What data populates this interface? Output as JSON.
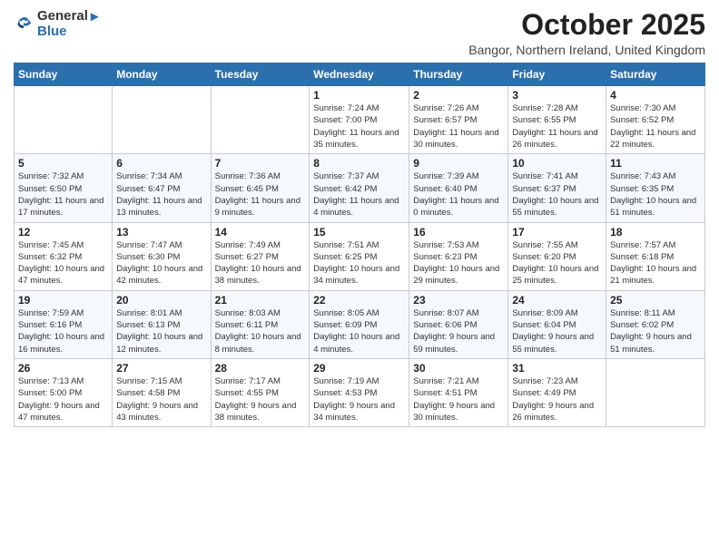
{
  "logo": {
    "general": "General",
    "blue": "Blue"
  },
  "header": {
    "month": "October 2025",
    "location": "Bangor, Northern Ireland, United Kingdom"
  },
  "weekdays": [
    "Sunday",
    "Monday",
    "Tuesday",
    "Wednesday",
    "Thursday",
    "Friday",
    "Saturday"
  ],
  "weeks": [
    [
      {
        "day": "",
        "sunrise": "",
        "sunset": "",
        "daylight": ""
      },
      {
        "day": "",
        "sunrise": "",
        "sunset": "",
        "daylight": ""
      },
      {
        "day": "",
        "sunrise": "",
        "sunset": "",
        "daylight": ""
      },
      {
        "day": "1",
        "sunrise": "Sunrise: 7:24 AM",
        "sunset": "Sunset: 7:00 PM",
        "daylight": "Daylight: 11 hours and 35 minutes."
      },
      {
        "day": "2",
        "sunrise": "Sunrise: 7:26 AM",
        "sunset": "Sunset: 6:57 PM",
        "daylight": "Daylight: 11 hours and 30 minutes."
      },
      {
        "day": "3",
        "sunrise": "Sunrise: 7:28 AM",
        "sunset": "Sunset: 6:55 PM",
        "daylight": "Daylight: 11 hours and 26 minutes."
      },
      {
        "day": "4",
        "sunrise": "Sunrise: 7:30 AM",
        "sunset": "Sunset: 6:52 PM",
        "daylight": "Daylight: 11 hours and 22 minutes."
      }
    ],
    [
      {
        "day": "5",
        "sunrise": "Sunrise: 7:32 AM",
        "sunset": "Sunset: 6:50 PM",
        "daylight": "Daylight: 11 hours and 17 minutes."
      },
      {
        "day": "6",
        "sunrise": "Sunrise: 7:34 AM",
        "sunset": "Sunset: 6:47 PM",
        "daylight": "Daylight: 11 hours and 13 minutes."
      },
      {
        "day": "7",
        "sunrise": "Sunrise: 7:36 AM",
        "sunset": "Sunset: 6:45 PM",
        "daylight": "Daylight: 11 hours and 9 minutes."
      },
      {
        "day": "8",
        "sunrise": "Sunrise: 7:37 AM",
        "sunset": "Sunset: 6:42 PM",
        "daylight": "Daylight: 11 hours and 4 minutes."
      },
      {
        "day": "9",
        "sunrise": "Sunrise: 7:39 AM",
        "sunset": "Sunset: 6:40 PM",
        "daylight": "Daylight: 11 hours and 0 minutes."
      },
      {
        "day": "10",
        "sunrise": "Sunrise: 7:41 AM",
        "sunset": "Sunset: 6:37 PM",
        "daylight": "Daylight: 10 hours and 55 minutes."
      },
      {
        "day": "11",
        "sunrise": "Sunrise: 7:43 AM",
        "sunset": "Sunset: 6:35 PM",
        "daylight": "Daylight: 10 hours and 51 minutes."
      }
    ],
    [
      {
        "day": "12",
        "sunrise": "Sunrise: 7:45 AM",
        "sunset": "Sunset: 6:32 PM",
        "daylight": "Daylight: 10 hours and 47 minutes."
      },
      {
        "day": "13",
        "sunrise": "Sunrise: 7:47 AM",
        "sunset": "Sunset: 6:30 PM",
        "daylight": "Daylight: 10 hours and 42 minutes."
      },
      {
        "day": "14",
        "sunrise": "Sunrise: 7:49 AM",
        "sunset": "Sunset: 6:27 PM",
        "daylight": "Daylight: 10 hours and 38 minutes."
      },
      {
        "day": "15",
        "sunrise": "Sunrise: 7:51 AM",
        "sunset": "Sunset: 6:25 PM",
        "daylight": "Daylight: 10 hours and 34 minutes."
      },
      {
        "day": "16",
        "sunrise": "Sunrise: 7:53 AM",
        "sunset": "Sunset: 6:23 PM",
        "daylight": "Daylight: 10 hours and 29 minutes."
      },
      {
        "day": "17",
        "sunrise": "Sunrise: 7:55 AM",
        "sunset": "Sunset: 6:20 PM",
        "daylight": "Daylight: 10 hours and 25 minutes."
      },
      {
        "day": "18",
        "sunrise": "Sunrise: 7:57 AM",
        "sunset": "Sunset: 6:18 PM",
        "daylight": "Daylight: 10 hours and 21 minutes."
      }
    ],
    [
      {
        "day": "19",
        "sunrise": "Sunrise: 7:59 AM",
        "sunset": "Sunset: 6:16 PM",
        "daylight": "Daylight: 10 hours and 16 minutes."
      },
      {
        "day": "20",
        "sunrise": "Sunrise: 8:01 AM",
        "sunset": "Sunset: 6:13 PM",
        "daylight": "Daylight: 10 hours and 12 minutes."
      },
      {
        "day": "21",
        "sunrise": "Sunrise: 8:03 AM",
        "sunset": "Sunset: 6:11 PM",
        "daylight": "Daylight: 10 hours and 8 minutes."
      },
      {
        "day": "22",
        "sunrise": "Sunrise: 8:05 AM",
        "sunset": "Sunset: 6:09 PM",
        "daylight": "Daylight: 10 hours and 4 minutes."
      },
      {
        "day": "23",
        "sunrise": "Sunrise: 8:07 AM",
        "sunset": "Sunset: 6:06 PM",
        "daylight": "Daylight: 9 hours and 59 minutes."
      },
      {
        "day": "24",
        "sunrise": "Sunrise: 8:09 AM",
        "sunset": "Sunset: 6:04 PM",
        "daylight": "Daylight: 9 hours and 55 minutes."
      },
      {
        "day": "25",
        "sunrise": "Sunrise: 8:11 AM",
        "sunset": "Sunset: 6:02 PM",
        "daylight": "Daylight: 9 hours and 51 minutes."
      }
    ],
    [
      {
        "day": "26",
        "sunrise": "Sunrise: 7:13 AM",
        "sunset": "Sunset: 5:00 PM",
        "daylight": "Daylight: 9 hours and 47 minutes."
      },
      {
        "day": "27",
        "sunrise": "Sunrise: 7:15 AM",
        "sunset": "Sunset: 4:58 PM",
        "daylight": "Daylight: 9 hours and 43 minutes."
      },
      {
        "day": "28",
        "sunrise": "Sunrise: 7:17 AM",
        "sunset": "Sunset: 4:55 PM",
        "daylight": "Daylight: 9 hours and 38 minutes."
      },
      {
        "day": "29",
        "sunrise": "Sunrise: 7:19 AM",
        "sunset": "Sunset: 4:53 PM",
        "daylight": "Daylight: 9 hours and 34 minutes."
      },
      {
        "day": "30",
        "sunrise": "Sunrise: 7:21 AM",
        "sunset": "Sunset: 4:51 PM",
        "daylight": "Daylight: 9 hours and 30 minutes."
      },
      {
        "day": "31",
        "sunrise": "Sunrise: 7:23 AM",
        "sunset": "Sunset: 4:49 PM",
        "daylight": "Daylight: 9 hours and 26 minutes."
      },
      {
        "day": "",
        "sunrise": "",
        "sunset": "",
        "daylight": ""
      }
    ]
  ]
}
